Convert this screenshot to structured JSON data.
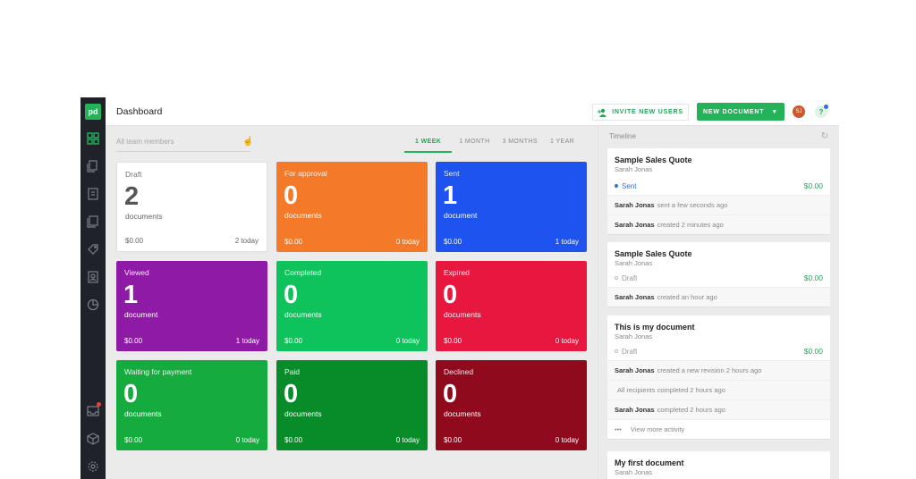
{
  "app": {
    "logo": "pd",
    "title": "Dashboard"
  },
  "header": {
    "invite_label": "INVITE NEW USERS",
    "new_document_label": "NEW DOCUMENT",
    "avatar_initials": "SJ",
    "help_label": "?"
  },
  "filter": {
    "placeholder": "All team members"
  },
  "periods": [
    "1 WEEK",
    "1 MONTH",
    "3 MONTHS",
    "1 YEAR"
  ],
  "cards": [
    {
      "label": "Draft",
      "count": "2",
      "unit": "documents",
      "amount": "$0.00",
      "today": "2 today",
      "color": "#ffffff"
    },
    {
      "label": "For approval",
      "count": "0",
      "unit": "documents",
      "amount": "$0.00",
      "today": "0 today",
      "color": "#f47a2a"
    },
    {
      "label": "Sent",
      "count": "1",
      "unit": "document",
      "amount": "$0.00",
      "today": "1 today",
      "color": "#1f53f0"
    },
    {
      "label": "Viewed",
      "count": "1",
      "unit": "document",
      "amount": "$0.00",
      "today": "1 today",
      "color": "#8e1aa6"
    },
    {
      "label": "Completed",
      "count": "0",
      "unit": "documents",
      "amount": "$0.00",
      "today": "0 today",
      "color": "#0ec35b"
    },
    {
      "label": "Expired",
      "count": "0",
      "unit": "documents",
      "amount": "$0.00",
      "today": "0 today",
      "color": "#e8173f"
    },
    {
      "label": "Waiting for payment",
      "count": "0",
      "unit": "documents",
      "amount": "$0.00",
      "today": "0 today",
      "color": "#16ab3f"
    },
    {
      "label": "Paid",
      "count": "0",
      "unit": "documents",
      "amount": "$0.00",
      "today": "0 today",
      "color": "#088c2a"
    },
    {
      "label": "Declined",
      "count": "0",
      "unit": "documents",
      "amount": "$0.00",
      "today": "0 today",
      "color": "#8e0a1c"
    }
  ],
  "timeline": {
    "title": "Timeline",
    "items": [
      {
        "doc": "Sample Sales Quote",
        "author": "Sarah Jonas",
        "status": "Sent",
        "price": "$0.00",
        "activities": [
          {
            "who": "Sarah Jonas",
            "what": "sent a few seconds ago"
          },
          {
            "who": "Sarah Jonas",
            "what": "created 2 minutes ago"
          }
        ]
      },
      {
        "doc": "Sample Sales Quote",
        "author": "Sarah Jonas",
        "status": "Draft",
        "price": "$0.00",
        "activities": [
          {
            "who": "Sarah Jonas",
            "what": "created an hour ago"
          }
        ]
      },
      {
        "doc": "This is my document",
        "author": "Sarah Jonas",
        "status": "Draft",
        "price": "$0.00",
        "activities": [
          {
            "who": "Sarah Jonas",
            "what": "created a new revision 2 hours ago"
          },
          {
            "who": "",
            "what": "All recipients completed 2 hours ago"
          },
          {
            "who": "Sarah Jonas",
            "what": "completed 2 hours ago"
          }
        ],
        "more": "View more activity"
      },
      {
        "doc": "My first document",
        "author": "Sarah Jonas"
      }
    ]
  },
  "colors": {
    "brand_green": "#25b35a",
    "sidebar_bg": "#1f2229",
    "sent_blue": "#2f6fe0"
  },
  "icons": [
    "dashboard-icon",
    "documents-icon",
    "templates-icon",
    "content-library-icon",
    "catalog-icon",
    "contacts-icon",
    "reports-icon",
    "inbox-icon",
    "integrations-icon",
    "settings-icon"
  ]
}
